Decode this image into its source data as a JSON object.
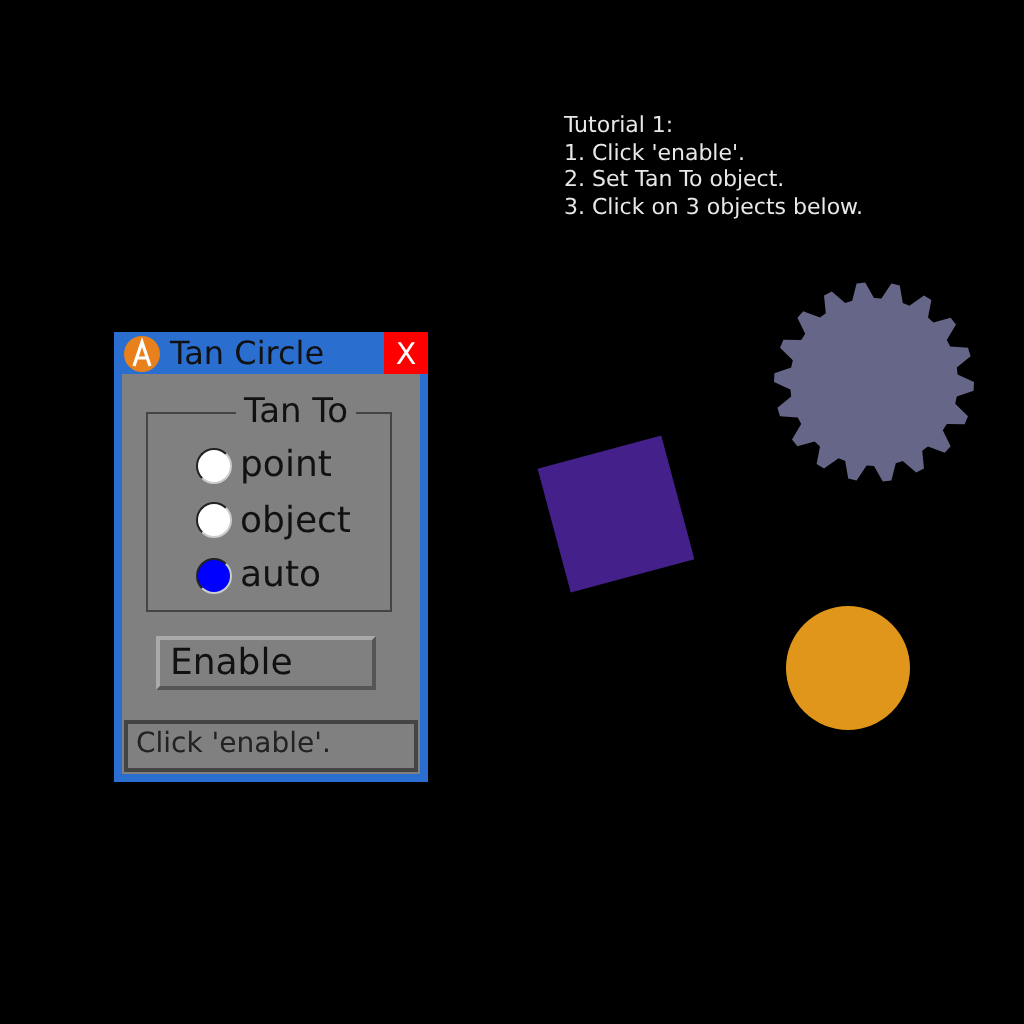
{
  "tutorial": {
    "lines": [
      "Tutorial 1:",
      "1. Click 'enable'.",
      "2. Set Tan To object.",
      "3. Click on 3 objects below."
    ]
  },
  "window": {
    "title": "Tan Circle",
    "close": "X"
  },
  "group": {
    "label": "Tan To",
    "options": [
      {
        "label": "point",
        "selected": false
      },
      {
        "label": "object",
        "selected": false
      },
      {
        "label": "auto",
        "selected": true
      }
    ]
  },
  "button": "Enable",
  "status": "Click 'enable'.",
  "shapes": [
    {
      "kind": "square"
    },
    {
      "kind": "gear"
    },
    {
      "kind": "circle"
    }
  ]
}
